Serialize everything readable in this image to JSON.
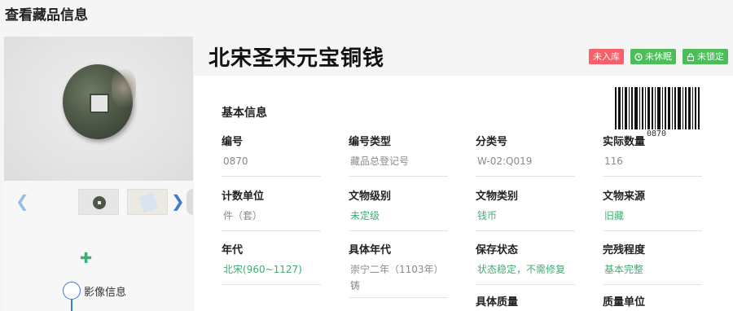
{
  "page": {
    "title": "查看藏品信息"
  },
  "item": {
    "title": "北宋圣宋元宝铜钱"
  },
  "badges": [
    {
      "label": "未入库",
      "color": "#f5606a",
      "icon": ""
    },
    {
      "label": "未休眠",
      "color": "#4cbd5a",
      "icon": "clock-icon"
    },
    {
      "label": "未锁定",
      "color": "#4cbd5a",
      "icon": "lock-icon"
    }
  ],
  "gallery": {
    "prev_icon": "chevron-left-icon",
    "next_icon": "chevron-right-icon",
    "add_icon": "plus-icon"
  },
  "timeline": {
    "label": "影像信息"
  },
  "barcode": {
    "number": "0870"
  },
  "basic_info": {
    "title": "基本信息",
    "fields": [
      {
        "label": "编号",
        "value": "0870",
        "value_color": "gray"
      },
      {
        "label": "编号类型",
        "value": "藏品总登记号",
        "value_color": "gray"
      },
      {
        "label": "分类号",
        "value": "W-02:Q019",
        "value_color": "gray"
      },
      {
        "label": "实际数量",
        "value": "116",
        "value_color": "gray"
      },
      {
        "label": "计数单位",
        "value": "件（套）",
        "value_color": "gray"
      },
      {
        "label": "文物级别",
        "value": "未定级",
        "value_color": "green"
      },
      {
        "label": "文物类别",
        "value": "钱币",
        "value_color": "green"
      },
      {
        "label": "文物来源",
        "value": "旧藏",
        "value_color": "green"
      },
      {
        "label": "年代",
        "value": "北宋(960~1127)",
        "value_color": "green"
      },
      {
        "label": "具体年代",
        "value": "崇宁二年（1103年）铸",
        "value_color": "gray"
      },
      {
        "label": "保存状态",
        "value": "状态稳定，不需修复",
        "value_color": "green"
      },
      {
        "label": "完残程度",
        "value": "基本完整",
        "value_color": "green"
      },
      {
        "label": "具体质量",
        "value": "",
        "value_color": "gray"
      },
      {
        "label": "质量单位",
        "value": "",
        "value_color": "gray"
      }
    ]
  }
}
